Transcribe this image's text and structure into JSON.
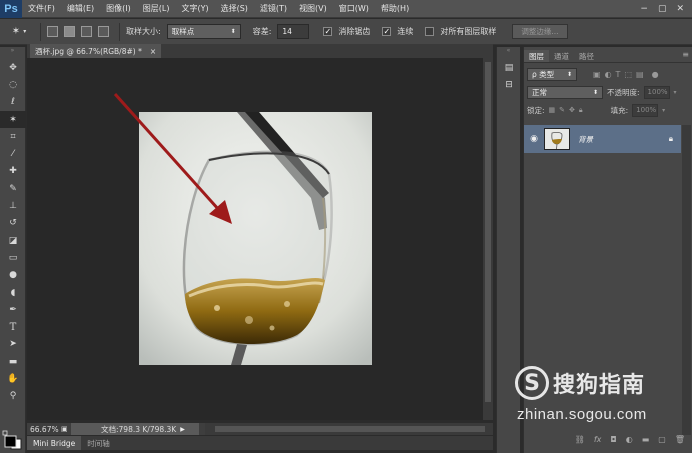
{
  "app": {
    "logo": "Ps"
  },
  "menu": [
    "文件(F)",
    "编辑(E)",
    "图像(I)",
    "图层(L)",
    "文字(Y)",
    "选择(S)",
    "滤镜(T)",
    "视图(V)",
    "窗口(W)",
    "帮助(H)"
  ],
  "window_controls": {
    "minimize": "−",
    "restore": "▢",
    "close": "✕"
  },
  "options": {
    "sample_size_label": "取样大小:",
    "sample_size_value": "取样点",
    "tolerance_label": "容差:",
    "tolerance_value": "14",
    "anti_alias_label": "消除锯齿",
    "contiguous_label": "连续",
    "sample_all_label": "对所有图层取样",
    "refine_edge_label": "调整边缘..."
  },
  "document": {
    "tab_title": "酒杯.jpg @ 66.7%(RGB/8#) *",
    "tab_close": "×",
    "zoom": "66.67%",
    "doc_info": "文档:798.3 K/798.3K"
  },
  "bottom_tabs": [
    "Mini Bridge",
    "时间轴"
  ],
  "layers_panel": {
    "tabs": [
      "图层",
      "通道",
      "路径"
    ],
    "filter_kind": "ρ 类型",
    "blend_mode": "正常",
    "opacity_label": "不透明度:",
    "opacity_value": "100%",
    "lock_label": "锁定:",
    "fill_label": "填充:",
    "fill_value": "100%",
    "layer_name": "背景"
  },
  "watermark": {
    "logo": "S",
    "title": "搜狗指南",
    "url": "zhinan.sogou.com"
  },
  "colors": {
    "accent_red": "#9e1b1b",
    "layer_selected": "#5c6f88",
    "ps_blue": "#1e3d66"
  }
}
